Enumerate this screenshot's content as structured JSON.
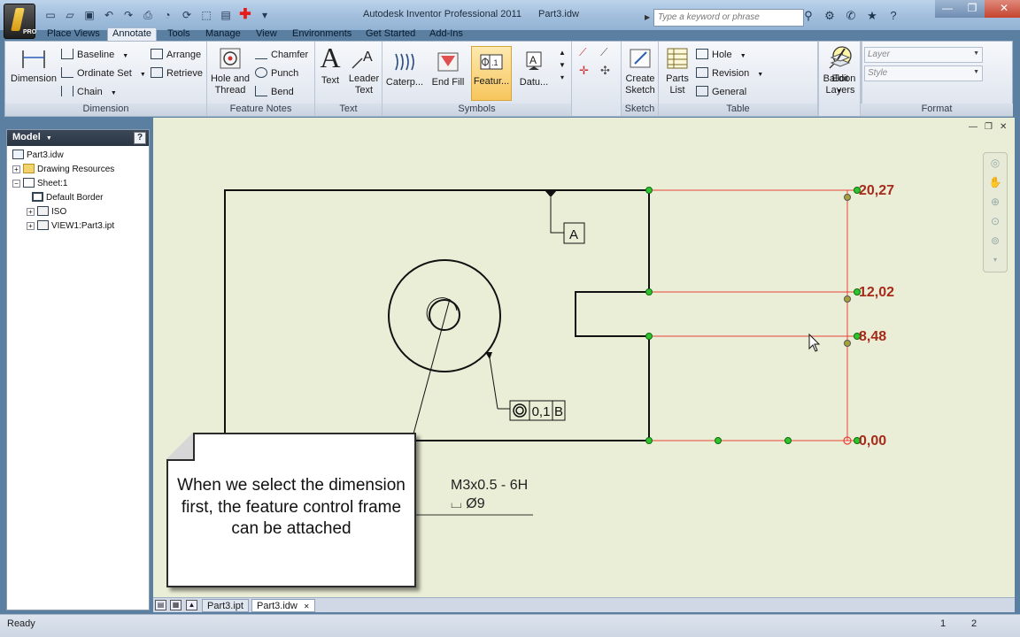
{
  "window": {
    "app_title": "Autodesk Inventor Professional 2011",
    "doc_title": "Part3.idw",
    "app_badge": "PRO",
    "search_placeholder": "Type a keyword or phrase"
  },
  "tabs": [
    {
      "label": "Place Views"
    },
    {
      "label": "Annotate",
      "active": true
    },
    {
      "label": "Tools"
    },
    {
      "label": "Manage"
    },
    {
      "label": "View"
    },
    {
      "label": "Environments"
    },
    {
      "label": "Get Started"
    },
    {
      "label": "Add-Ins"
    }
  ],
  "ribbon": {
    "dimension_group": {
      "label": "Dimension",
      "dimension": "Dimension",
      "baseline": "Baseline",
      "ordinate_set": "Ordinate Set",
      "chain": "Chain",
      "arrange": "Arrange",
      "retrieve": "Retrieve"
    },
    "feature_notes_group": {
      "label": "Feature Notes",
      "hole_thread_1": "Hole and",
      "hole_thread_2": "Thread",
      "chamfer": "Chamfer",
      "punch": "Punch",
      "bend": "Bend"
    },
    "text_group": {
      "label": "Text",
      "text": "Text",
      "leader_1": "Leader",
      "leader_2": "Text"
    },
    "symbols_group": {
      "label": "Symbols",
      "caterpillar": "Caterp...",
      "end_fill": "End Fill",
      "feature": "Featur...",
      "datum": "Datu..."
    },
    "sketch_group": {
      "label": "Sketch",
      "create_1": "Create",
      "create_2": "Sketch"
    },
    "table_group": {
      "label": "Table",
      "parts_1": "Parts",
      "parts_2": "List",
      "hole": "Hole",
      "revision": "Revision",
      "general": "General"
    },
    "balloon_group": {
      "balloon": "Balloon",
      "balloon_number": "1",
      "edit_1": "Edit",
      "edit_2": "Layers"
    },
    "format_group": {
      "label": "Format",
      "layer_placeholder": "Layer",
      "style_placeholder": "Style"
    }
  },
  "browser": {
    "header": "Model",
    "help": "?",
    "items": [
      {
        "label": "Part3.idw"
      },
      {
        "label": "Drawing Resources"
      },
      {
        "label": "Sheet:1"
      },
      {
        "label": "Default Border"
      },
      {
        "label": "ISO"
      },
      {
        "label": "VIEW1:Part3.ipt"
      }
    ]
  },
  "drawing": {
    "datum_a": "A",
    "fcf_tolerance": "0,1",
    "fcf_datum": "B",
    "hole_note_line1": "M3x0.5 - 6H",
    "hole_note_line2": "⌴ Ø9",
    "ordinates": [
      "20,27",
      "12,02",
      "8,48",
      "0,00"
    ],
    "accent_color": "#e8413b",
    "ordinate_text_color": "#a52a1a"
  },
  "callout": {
    "text": "When we select the dimension first, the feature control frame can be attached"
  },
  "doc_tabs": [
    {
      "label": "Part3.ipt"
    },
    {
      "label": "Part3.idw",
      "active": true
    }
  ],
  "status": {
    "text": "Ready",
    "page_a": "1",
    "page_b": "2"
  }
}
